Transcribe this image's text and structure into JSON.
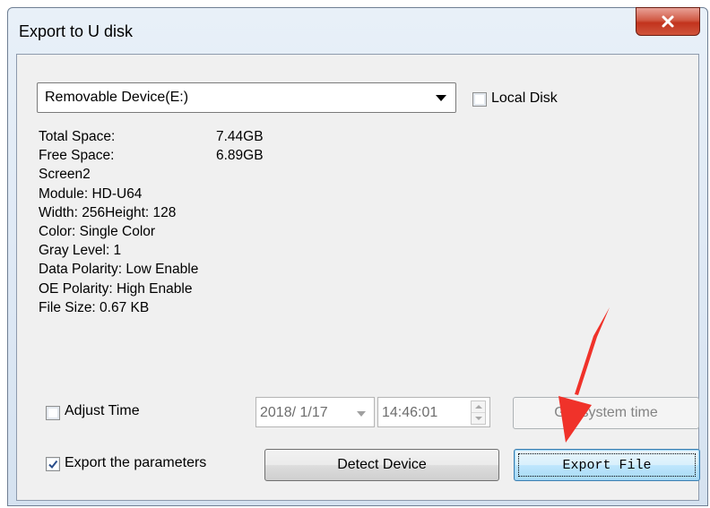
{
  "window": {
    "title": "Export to U disk",
    "close_icon": "close-icon"
  },
  "device": {
    "selected": "Removable Device(E:)",
    "local_disk_label": "Local Disk",
    "local_disk_checked": false
  },
  "info": {
    "total_label": "Total Space:",
    "total_value": "7.44GB",
    "free_label": "Free Space:",
    "free_value": "6.89GB",
    "lines": [
      "Screen2",
      "Module: HD-U64",
      "Width: 256Height: 128",
      "Color: Single Color",
      "Gray Level: 1",
      "Data Polarity: Low Enable",
      "OE Polarity: High Enable",
      "File Size: 0.67 KB"
    ]
  },
  "time": {
    "adjust_label": "Adjust Time",
    "adjust_checked": false,
    "date_value": "2018/ 1/17",
    "time_value": "14:46:01",
    "get_system_time_label": "Get system time"
  },
  "bottom": {
    "export_params_label": "Export the parameters",
    "export_params_checked": true,
    "detect_label": "Detect Device",
    "export_file_label": "Export File"
  },
  "colors": {
    "annotation_arrow": "#f0322a",
    "close_button": "#c2331d"
  }
}
